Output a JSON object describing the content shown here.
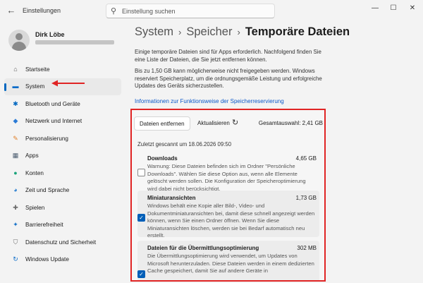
{
  "titlebar": {
    "back_icon": "arrow-left-icon",
    "app_title": "Einstellungen",
    "search_placeholder": "Einstellung suchen"
  },
  "user": {
    "name": "Dirk Löbe"
  },
  "sidebar": {
    "items": [
      {
        "label": "Startseite",
        "icon": "home-icon",
        "glyph": "⌂",
        "color": "#5a5a5a",
        "active": false
      },
      {
        "label": "System",
        "icon": "monitor-icon",
        "glyph": "▬",
        "color": "#0a6cc9",
        "active": true
      },
      {
        "label": "Bluetooth und Geräte",
        "icon": "bluetooth-icon",
        "glyph": "✱",
        "color": "#0067c0",
        "active": false
      },
      {
        "label": "Netzwerk und Internet",
        "icon": "wifi-icon",
        "glyph": "◆",
        "color": "#2b7bd6",
        "active": false
      },
      {
        "label": "Personalisierung",
        "icon": "brush-icon",
        "glyph": "✎",
        "color": "#e0802b",
        "active": false
      },
      {
        "label": "Apps",
        "icon": "apps-icon",
        "glyph": "▦",
        "color": "#4a5b6e",
        "active": false
      },
      {
        "label": "Konten",
        "icon": "account-icon",
        "glyph": "●",
        "color": "#1aa37a",
        "active": false
      },
      {
        "label": "Zeit und Sprache",
        "icon": "globe-clock-icon",
        "glyph": "◕",
        "color": "#2a7fd1",
        "active": false
      },
      {
        "label": "Spielen",
        "icon": "gamepad-icon",
        "glyph": "✚",
        "color": "#6b6b6b",
        "active": false
      },
      {
        "label": "Barrierefreiheit",
        "icon": "accessibility-icon",
        "glyph": "✦",
        "color": "#1a73c8",
        "active": false
      },
      {
        "label": "Datenschutz und Sicherheit",
        "icon": "shield-icon",
        "glyph": "⛉",
        "color": "#6b6b6b",
        "active": false
      },
      {
        "label": "Windows Update",
        "icon": "update-icon",
        "glyph": "↻",
        "color": "#0a6cc9",
        "active": false
      }
    ]
  },
  "breadcrumb": {
    "items": [
      "System",
      "Speicher"
    ],
    "current": "Temporäre Dateien",
    "separator": "›"
  },
  "main": {
    "intro": "Einige temporäre Dateien sind für Apps erforderlich. Nachfolgend finden Sie eine Liste der Dateien, die Sie jetzt entfernen können.",
    "warning": "Bis zu 1,50 GB kann möglicherweise nicht freigegeben werden. Windows reserviert Speicherplatz, um die ordnungsgemäße Leistung und erfolgreiche Updates des Geräts sicherzustellen.",
    "info_link": "Informationen zur Funktionsweise der Speicherreservierung",
    "remove_button": "Dateien entfernen",
    "refresh": "Aktualisieren",
    "total_selection": "Gesamtauswahl: 2,41 GB",
    "last_scanned": "Zuletzt gescannt um 18.06.2026 09:50",
    "files": [
      {
        "title": "Downloads",
        "size": "4,65 GB",
        "checked": false,
        "desc": "Warnung: Diese Dateien befinden sich im Ordner \"Persönliche Downloads\". Wählen Sie diese Option aus, wenn alle Elemente gelöscht werden sollen. Die Konfiguration der Speicheroptimierung wird dabei nicht berücksichtigt."
      },
      {
        "title": "Miniaturansichten",
        "size": "1,73 GB",
        "checked": true,
        "desc": "Windows behält eine Kopie aller Bild-, Video- und Dokumentminiaturansichten bei, damit diese schnell angezeigt werden können, wenn Sie einen Ordner öffnen. Wenn Sie diese Miniaturansichten löschen, werden sie bei Bedarf automatisch neu erstellt."
      },
      {
        "title": "Dateien für die Übermittlungsoptimierung",
        "size": "302 MB",
        "checked": true,
        "desc": "Die Übermittlungsoptimierung wird verwendet, um Updates von Microsoft herunterzuladen. Diese Dateien werden in einem dedizierten Cache gespeichert, damit Sie auf andere Geräte in"
      }
    ]
  },
  "colors": {
    "accent": "#0067c0",
    "highlight_border": "#e02424",
    "arrow": "#e02424"
  }
}
